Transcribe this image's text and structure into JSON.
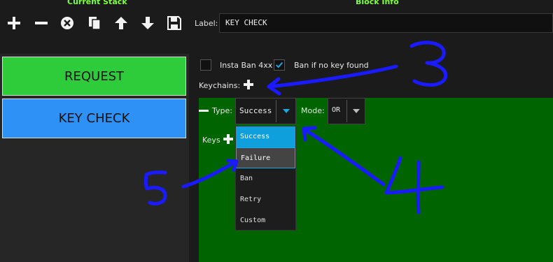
{
  "headers": {
    "current_stack": "Current Stack",
    "block_info": "Block Info"
  },
  "toolbar": {
    "icons": [
      "plus-icon",
      "minus-icon",
      "close-circle-icon",
      "copy-icon",
      "arrow-up-icon",
      "arrow-down-icon",
      "save-icon"
    ]
  },
  "label_field": {
    "label": "Label:",
    "value": "KEY CHECK"
  },
  "stack": {
    "items": [
      {
        "label": "REQUEST",
        "color": "#2ecc3a"
      },
      {
        "label": "KEY CHECK",
        "color": "#2d91f5"
      }
    ]
  },
  "options": {
    "insta_ban": {
      "label": "Insta Ban 4xx",
      "checked": false
    },
    "ban_if_no_key": {
      "label": "Ban if no key found",
      "checked": true
    }
  },
  "keychains": {
    "label": "Keychains:"
  },
  "keychain": {
    "type_label": "Type:",
    "type_value": "Success",
    "mode_label": "Mode:",
    "mode_value": "OR",
    "keys_label": "Keys",
    "type_options": [
      "Success",
      "Failure",
      "Ban",
      "Retry",
      "Custom"
    ],
    "highlighted_option": "Failure",
    "background_color": "#006400"
  },
  "annotations": {
    "numbers": [
      "3",
      "4",
      "5"
    ],
    "color": "#1a1aff"
  }
}
